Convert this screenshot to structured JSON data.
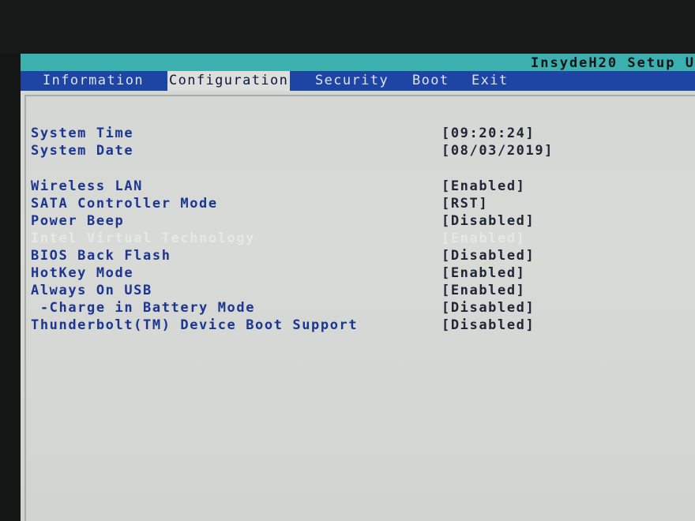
{
  "header": {
    "title": "InsydeH20 Setup U"
  },
  "menu": {
    "tabs": [
      {
        "label": "Information",
        "active": false
      },
      {
        "label": "Configuration",
        "active": true
      },
      {
        "label": "Security",
        "active": false
      },
      {
        "label": "Boot",
        "active": false
      },
      {
        "label": "Exit",
        "active": false
      }
    ]
  },
  "settings": [
    {
      "label": "System Time",
      "value": "[09:20:24]"
    },
    {
      "label": "System Date",
      "value": "[08/03/2019]"
    },
    {
      "label": "Wireless LAN",
      "value": "[Enabled]"
    },
    {
      "label": "SATA Controller Mode",
      "value": "[RST]"
    },
    {
      "label": "Power Beep",
      "value": "[Disabled]"
    },
    {
      "label": "Intel Virtual Technology",
      "value": "[Enabled]",
      "greyed": true
    },
    {
      "label": "BIOS Back Flash",
      "value": "[Disabled]"
    },
    {
      "label": "HotKey Mode",
      "value": "[Enabled]"
    },
    {
      "label": "Always On USB",
      "value": "[Enabled]"
    },
    {
      "label": " -Charge in Battery Mode",
      "value": "[Disabled]"
    },
    {
      "label": "Thunderbolt(TM) Device Boot Support",
      "value": "[Disabled]"
    }
  ],
  "colors": {
    "header_strip": "#3cb0ae",
    "menubar": "#1f45a4",
    "screen_bg": "#d5d7d4",
    "label_text": "#1c3591",
    "greyed_text": "#e6e8e6"
  }
}
